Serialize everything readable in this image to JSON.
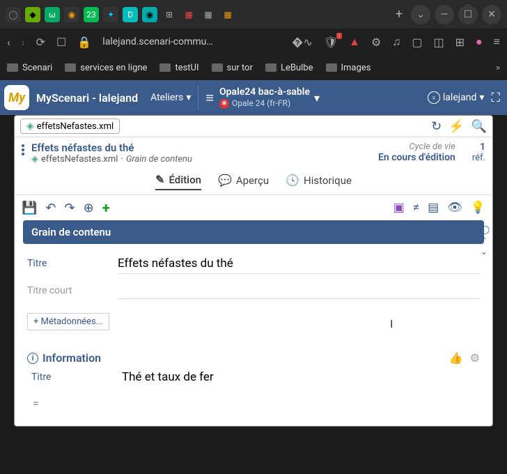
{
  "browser": {
    "url": "lalejand.scenari-commu…",
    "bookmarks": [
      "Scenari",
      "services en ligne",
      "testUI",
      "sur tor",
      "LeBulbe",
      "Images"
    ]
  },
  "app": {
    "header_title": "MyScenari - lalejand",
    "logo_text": "My",
    "ateliers_label": "Ateliers",
    "menu_icon": "≡",
    "workspace_name": "Opale24 bac-à-sable",
    "workspace_label": "Opale 24 (fr-FR)",
    "user": "lalejand"
  },
  "file": {
    "tab_name": "effetsNefastes.xml",
    "doc_title": "Effets néfastes du thé",
    "doc_path": "effetsNefastes.xml",
    "doc_type": "Grain de contenu",
    "cycle_label": "Cycle de vie",
    "status": "En cours d'édition",
    "ref_count": "1",
    "ref_label": "réf."
  },
  "tabs": {
    "edition": "Édition",
    "apercu": "Aperçu",
    "historique": "Historique"
  },
  "editor": {
    "section_title": "Grain de contenu",
    "titre_label": "Titre",
    "titre_value": "Effets néfastes du thé",
    "titre_court_label": "Titre court",
    "titre_court_value": "",
    "metadata_btn": "+ Métadonnées...",
    "info_section": "Information",
    "info_titre_label": "Titre",
    "info_titre_value": "Thé et taux de fer",
    "equals": "="
  }
}
